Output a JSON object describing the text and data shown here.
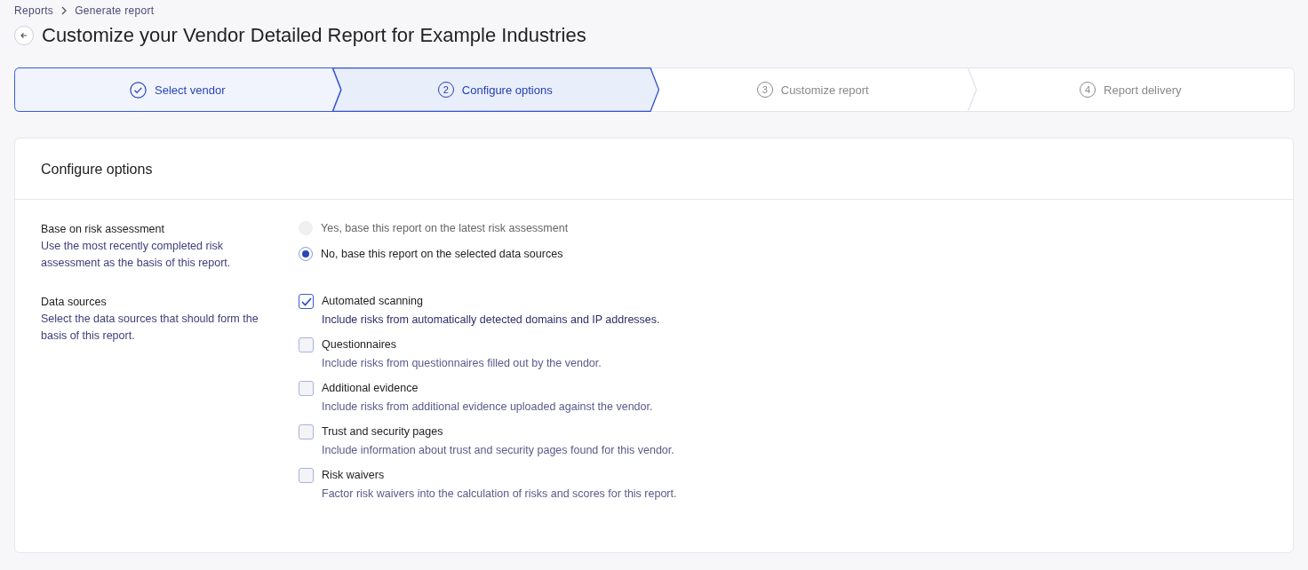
{
  "breadcrumbs": [
    {
      "label": "Reports"
    },
    {
      "label": "Generate report"
    }
  ],
  "title": "Customize your Vendor Detailed Report for Example Industries",
  "steps": [
    {
      "label": "Select vendor",
      "completed": true,
      "selected": false
    },
    {
      "number": "2",
      "label": "Configure options",
      "completed": false,
      "selected": true
    },
    {
      "number": "3",
      "label": "Customize report",
      "completed": false,
      "selected": false
    },
    {
      "number": "4",
      "label": "Report delivery",
      "completed": false,
      "selected": false
    }
  ],
  "card": {
    "title": "Configure options",
    "sections": [
      {
        "heading": "Base on risk assessment",
        "description": "Use the most recently completed risk assessment as the basis of this report.",
        "kind": "radio",
        "options": [
          {
            "label": "Yes, base this report on the latest risk assessment",
            "selected": false,
            "disabled": true
          },
          {
            "label": "No, base this report on the selected data sources",
            "selected": true,
            "disabled": false
          }
        ]
      },
      {
        "heading": "Data sources",
        "description": "Select the data sources that should form the basis of this report.",
        "kind": "checkbox",
        "options": [
          {
            "label": "Automated scanning",
            "description": "Include risks from automatically detected domains and IP addresses.",
            "checked": true
          },
          {
            "label": "Questionnaires",
            "description": "Include risks from questionnaires filled out by the vendor.",
            "checked": false
          },
          {
            "label": "Additional evidence",
            "description": "Include risks from additional evidence uploaded against the vendor.",
            "checked": false
          },
          {
            "label": "Trust and security pages",
            "description": "Include information about trust and security pages found for this vendor.",
            "checked": false
          },
          {
            "label": "Risk waivers",
            "description": "Factor risk waivers into the calculation of risks and scores for this report.",
            "checked": false
          }
        ]
      }
    ]
  }
}
